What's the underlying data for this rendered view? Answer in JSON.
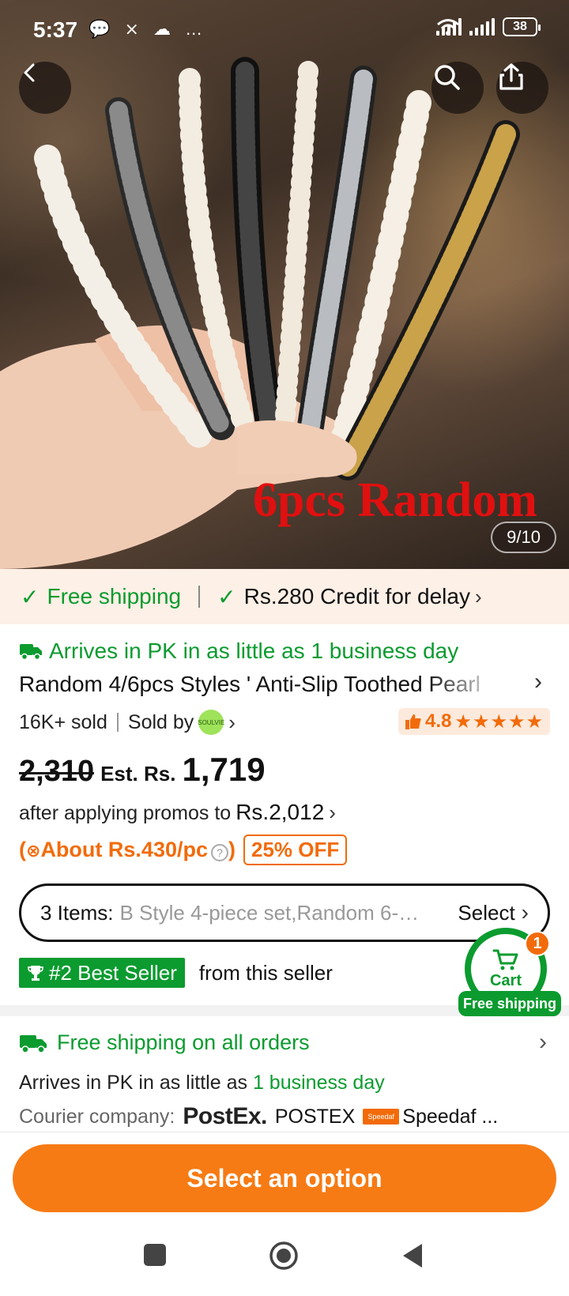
{
  "status_bar": {
    "time": "5:37",
    "notification_icons": "💬 ⨯ ☁ …",
    "battery": "38"
  },
  "hero": {
    "overlay_text": "6pcs  Random",
    "image_counter": "9/10",
    "buttons": [
      "back-icon",
      "search-icon",
      "share-icon"
    ]
  },
  "promo_strip": {
    "free_shipping": "Free shipping",
    "credit": "Rs.280 Credit for delay"
  },
  "product": {
    "arrival": "Arrives in PK in as little as 1 business day",
    "title": "Random 4/6pcs Styles ' Anti-Slip Toothed Pearl",
    "sold": "16K+ sold",
    "sold_by_label": "Sold by",
    "seller_logo_text": "SOULVIE",
    "rating": "4.8",
    "stars": "★★★★★",
    "old_price": "2,310",
    "est_label": "Est. Rs.",
    "est_price": "1,719",
    "promo_text": "after applying promos to",
    "promo_price": "Rs.2,012",
    "per_piece": "About Rs.430/pc",
    "discount": "25% OFF"
  },
  "selector": {
    "label": "3 Items:",
    "value": "B Style 4-piece set,Random 6-…",
    "action": "Select"
  },
  "best_seller": {
    "badge": "#2 Best Seller",
    "text": "from this seller"
  },
  "cart": {
    "label": "Cart",
    "count": "1",
    "shipping_tag": "Free shipping"
  },
  "shipping": {
    "heading": "Free shipping on all orders",
    "arrive_prefix": "Arrives in PK in as little as",
    "arrive_highlight": "1 business day",
    "courier_label": "Courier company:",
    "postex_logo": "PostEx.",
    "postex_name": "POSTEX",
    "speedaf_logo": "Speedaf",
    "speedaf_name": "Speedaf ..."
  },
  "cta": {
    "label": "Select an option"
  },
  "colors": {
    "green": "#0b9b2f",
    "orange": "#f26b0a",
    "cta": "#f77b14",
    "promo_bg": "#fdf0e6"
  }
}
